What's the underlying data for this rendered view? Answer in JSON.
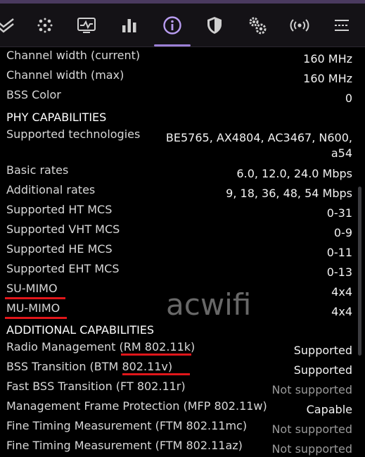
{
  "tabs": [
    {
      "name": "check-icon"
    },
    {
      "name": "dots-grid-icon"
    },
    {
      "name": "chart-monitor-icon"
    },
    {
      "name": "bar-chart-icon"
    },
    {
      "name": "info-icon",
      "active": true
    },
    {
      "name": "shield-icon"
    },
    {
      "name": "gears-icon"
    },
    {
      "name": "broadcast-icon"
    },
    {
      "name": "menu-icon"
    }
  ],
  "rows_top": [
    {
      "label": "Channel width (current)",
      "value": "160 MHz"
    },
    {
      "label": "Channel width (max)",
      "value": "160 MHz"
    },
    {
      "label": "BSS Color",
      "value": "0"
    }
  ],
  "phy": {
    "header": "PHY CAPABILITIES",
    "supported_technologies": {
      "label": "Supported technologies",
      "value_line1": "BE5765, AX4804, AC3467, N600,",
      "value_line2": "a54"
    },
    "rows": [
      {
        "label": "Basic rates",
        "value": "6.0, 12.0, 24.0 Mbps"
      },
      {
        "label": "Additional rates",
        "value": "9, 18, 36, 48, 54 Mbps"
      },
      {
        "label": "Supported HT MCS",
        "value": "0-31"
      },
      {
        "label": "Supported VHT MCS",
        "value": "0-9"
      },
      {
        "label": "Supported HE MCS",
        "value": "0-11"
      },
      {
        "label": "Supported EHT MCS",
        "value": "0-13"
      },
      {
        "label": "SU-MIMO",
        "value": "4x4"
      },
      {
        "label": "MU-MIMO",
        "value": "4x4"
      }
    ]
  },
  "additional": {
    "header": "ADDITIONAL CAPABILITIES",
    "rows": [
      {
        "label": "Radio Management (RM 802.11k)",
        "value": "Supported"
      },
      {
        "label": "BSS Transition (BTM 802.11v)",
        "value": "Supported"
      },
      {
        "label": "Fast BSS Transition (FT 802.11r)",
        "value": "Not supported"
      },
      {
        "label": "Management Frame Protection (MFP 802.11w)",
        "value": "Capable"
      },
      {
        "label": "Fine Timing Measurement (FTM 802.11mc)",
        "value": "Not supported"
      },
      {
        "label": "Fine Timing Measurement (FTM 802.11az)",
        "value": "Not supported"
      }
    ]
  },
  "watermark": "acwifi",
  "colors": {
    "accent": "#9b7fd6",
    "underline": "#e0161a",
    "tabbar": "#141216"
  }
}
